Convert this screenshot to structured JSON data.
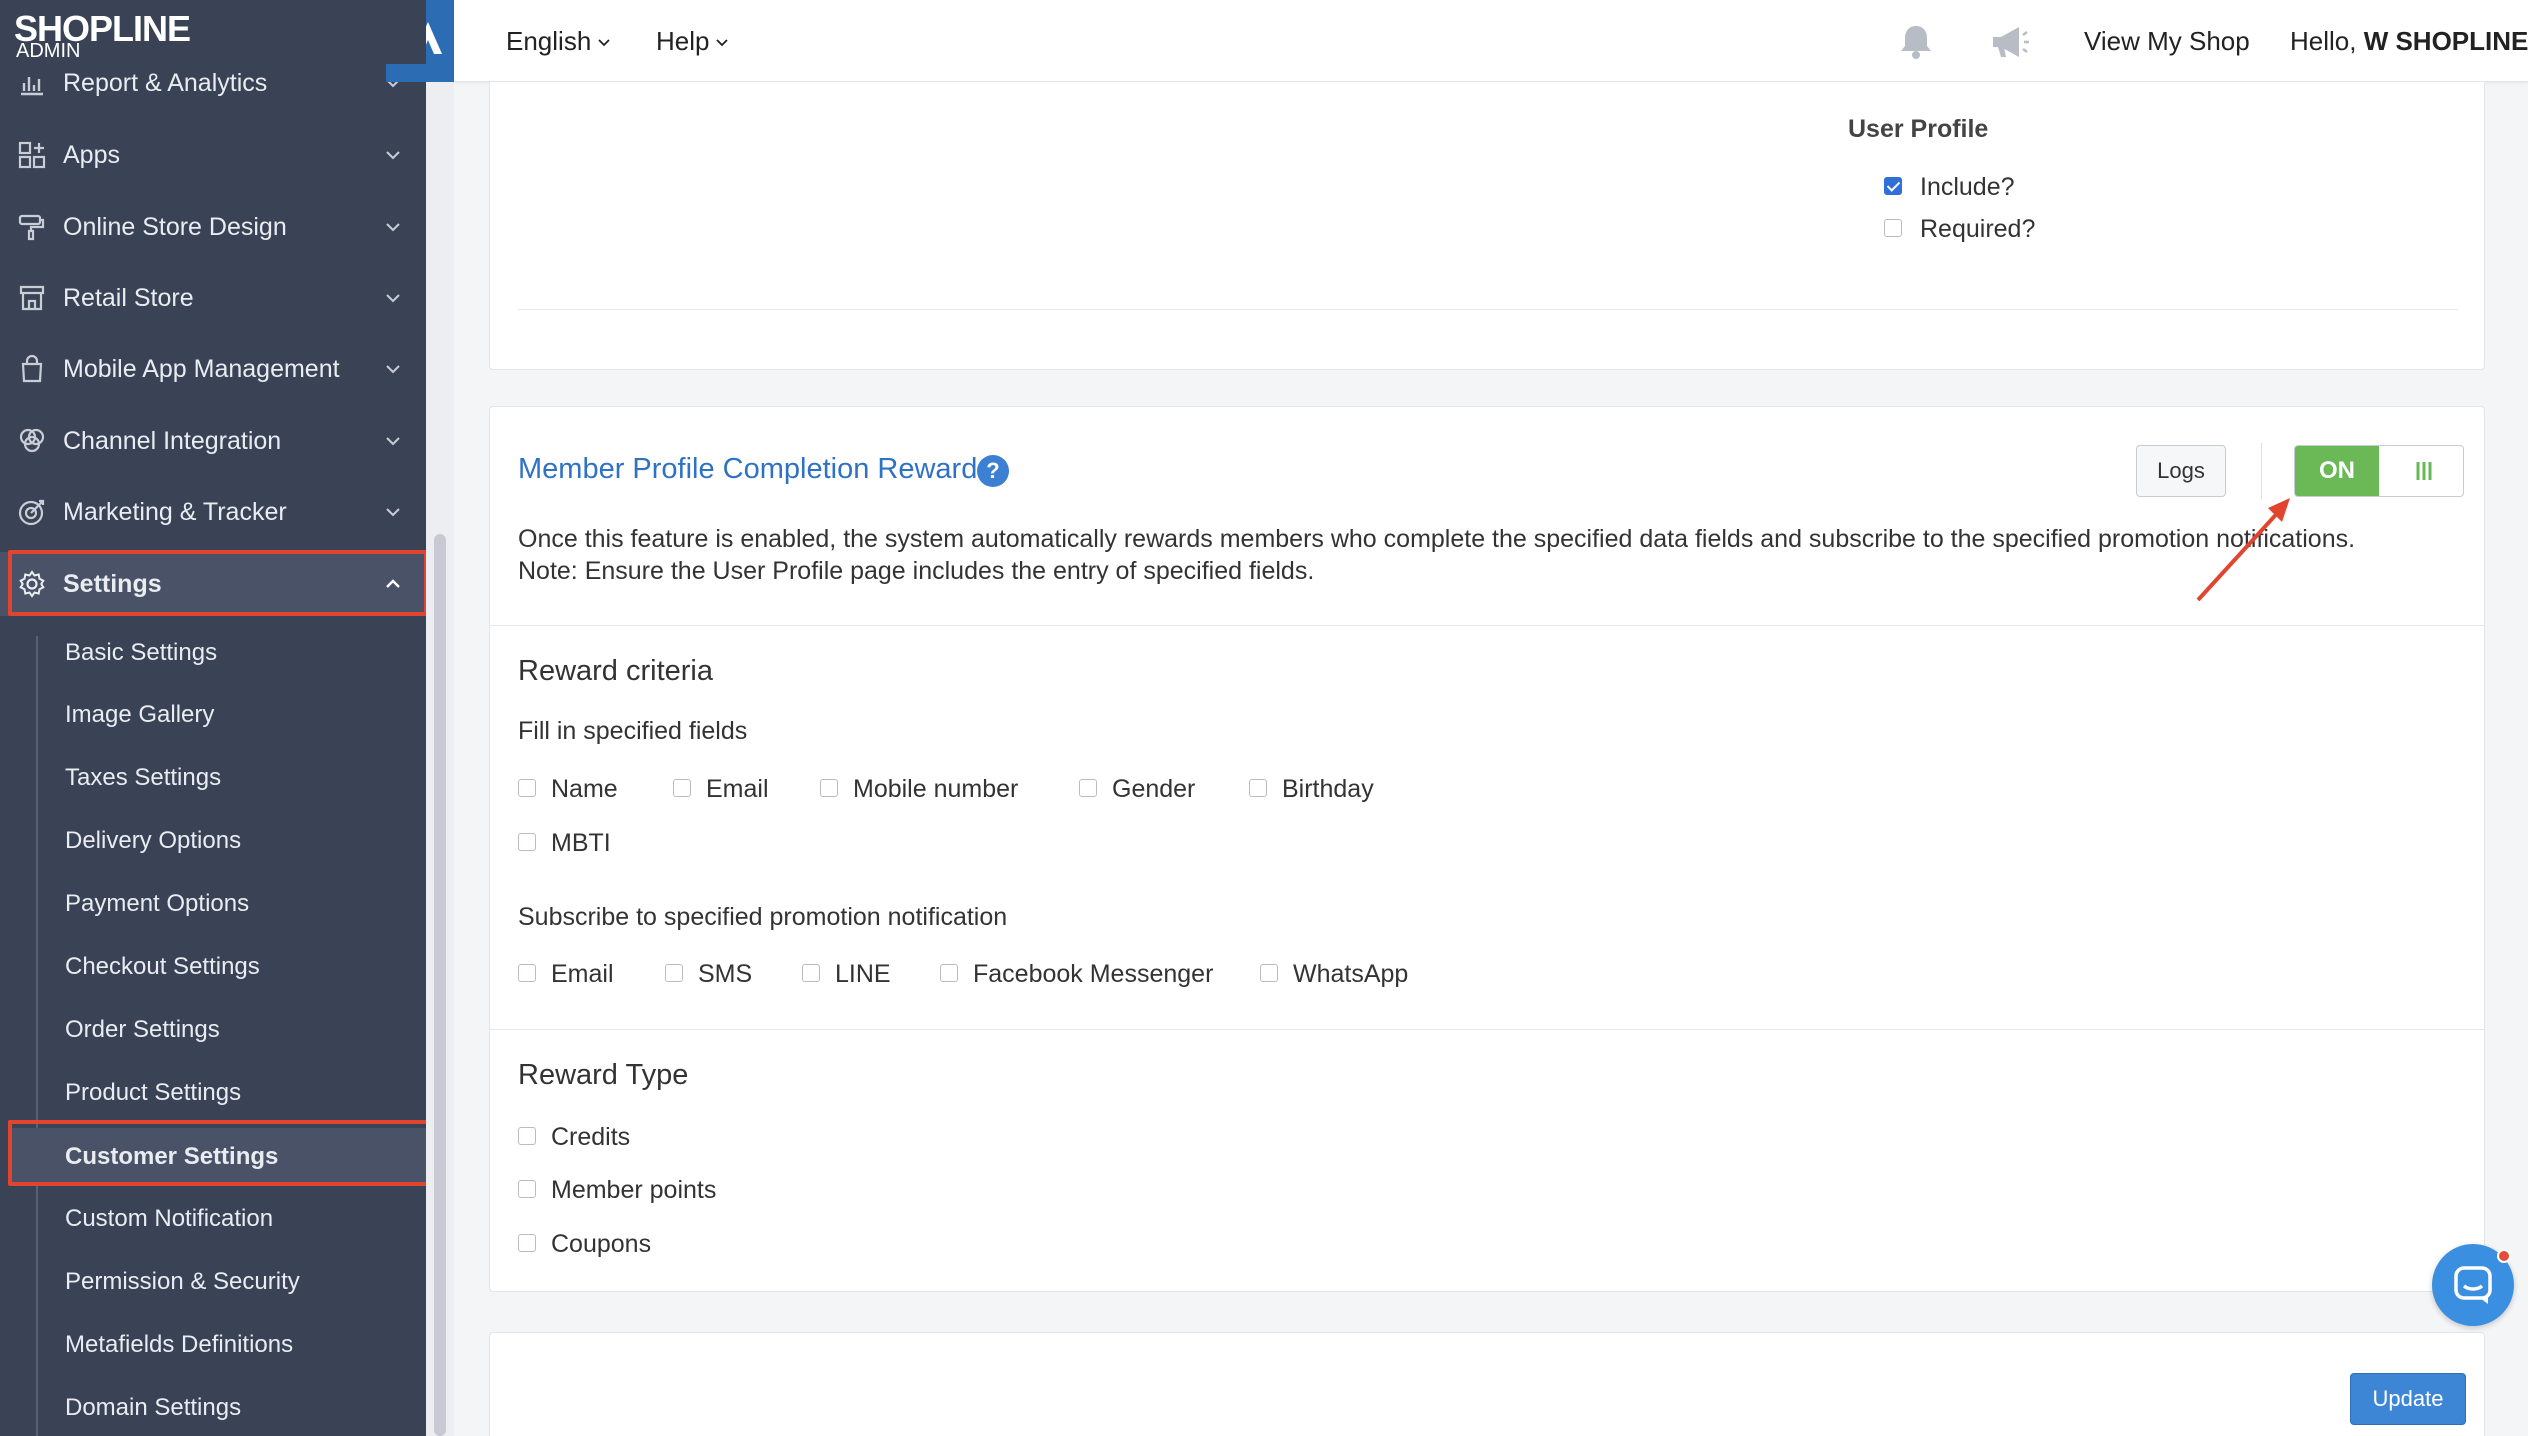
{
  "sidebar": {
    "logo": "SHOPLINE",
    "logo_sub": "ADMIN",
    "nav_items": [
      {
        "label": "Report & Analytics",
        "icon": "chart-icon"
      },
      {
        "label": "Apps",
        "icon": "apps-icon"
      },
      {
        "label": "Online Store Design",
        "icon": "paint-roller-icon"
      },
      {
        "label": "Retail Store",
        "icon": "store-icon"
      },
      {
        "label": "Mobile App Management",
        "icon": "shopping-bag-icon"
      },
      {
        "label": "Channel Integration",
        "icon": "channels-icon"
      },
      {
        "label": "Marketing & Tracker",
        "icon": "target-icon"
      },
      {
        "label": "Settings",
        "icon": "gear-icon",
        "expanded": true
      }
    ],
    "settings_items": [
      {
        "label": "Basic Settings"
      },
      {
        "label": "Image Gallery"
      },
      {
        "label": "Taxes Settings"
      },
      {
        "label": "Delivery Options"
      },
      {
        "label": "Payment Options"
      },
      {
        "label": "Checkout Settings"
      },
      {
        "label": "Order Settings"
      },
      {
        "label": "Product Settings"
      },
      {
        "label": "Customer Settings",
        "active": true
      },
      {
        "label": "Custom Notification"
      },
      {
        "label": "Permission & Security"
      },
      {
        "label": "Metafields Definitions"
      },
      {
        "label": "Domain Settings"
      }
    ]
  },
  "header": {
    "language": "English",
    "help": "Help",
    "view_shop": "View My Shop",
    "greeting": "Hello, ",
    "user": "W SHOPLINE"
  },
  "user_profile_card": {
    "title": "User Profile",
    "include_label": "Include?",
    "include_checked": true,
    "required_label": "Required?",
    "required_checked": false
  },
  "reward_card": {
    "title": "Member Profile Completion Reward",
    "logs_label": "Logs",
    "toggle_label": "ON",
    "toggle_state": "on",
    "description_line1": "Once this feature is enabled, the system automatically rewards members who complete the specified data fields and subscribe to the specified promotion notifications.",
    "description_line2": "Note: Ensure the User Profile page includes the entry of specified fields.",
    "criteria_title": "Reward criteria",
    "fields_title": "Fill in specified fields",
    "fields": [
      "Name",
      "Email",
      "Mobile number",
      "Gender",
      "Birthday",
      "MBTI"
    ],
    "subscribe_title": "Subscribe to specified promotion notification",
    "notifications": [
      "Email",
      "SMS",
      "LINE",
      "Facebook Messenger",
      "WhatsApp"
    ],
    "reward_type_title": "Reward Type",
    "reward_types": [
      "Credits",
      "Member points",
      "Coupons"
    ]
  },
  "footer": {
    "update_label": "Update"
  },
  "colors": {
    "sidebar_bg": "#3a4256",
    "accent_blue": "#3d7fd3",
    "toggle_green": "#6ab856",
    "highlight_red": "#e2452f"
  }
}
